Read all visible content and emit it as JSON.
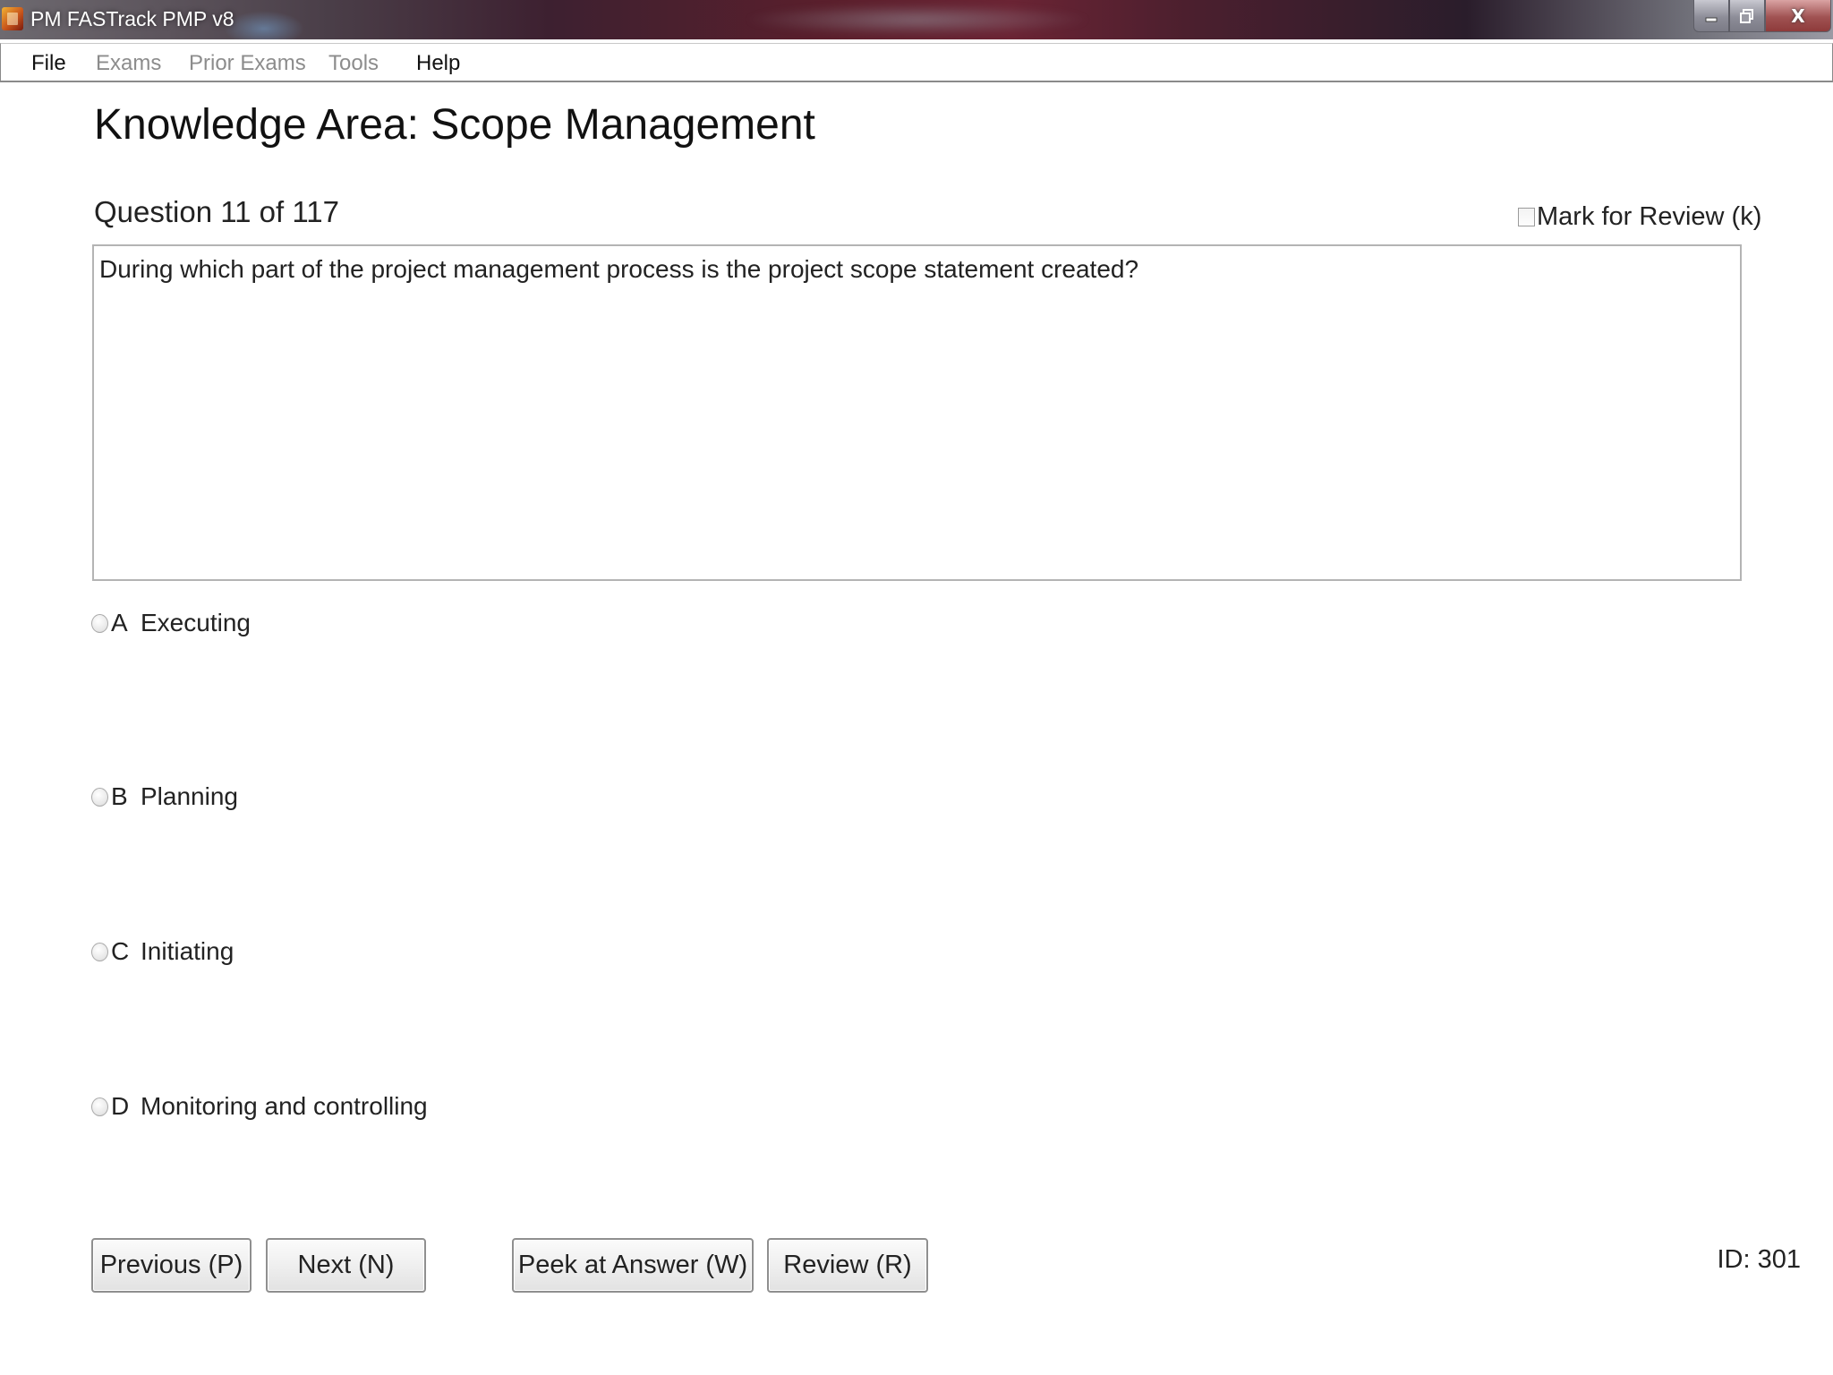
{
  "window": {
    "title": "PM FASTrack PMP v8",
    "controls": {
      "minimize_icon": "minimize-icon",
      "maximize_icon": "restore-icon",
      "close_label": "X"
    }
  },
  "menu": {
    "items": [
      {
        "label": "File",
        "enabled": true
      },
      {
        "label": "Exams",
        "enabled": false
      },
      {
        "label": "Prior Exams",
        "enabled": false
      },
      {
        "label": "Tools",
        "enabled": false
      },
      {
        "label": "Help",
        "enabled": true
      }
    ]
  },
  "page": {
    "heading": "Knowledge Area: Scope Management",
    "question_counter": "Question 11 of 117",
    "mark_for_review": {
      "label": "Mark for Review (k)",
      "checked": false
    },
    "question_text": "During which part of the project management process is the project scope statement created?",
    "answers": [
      {
        "letter": "A",
        "text": "Executing",
        "selected": false
      },
      {
        "letter": "B",
        "text": "Planning",
        "selected": false
      },
      {
        "letter": "C",
        "text": "Initiating",
        "selected": false
      },
      {
        "letter": "D",
        "text": "Monitoring and controlling",
        "selected": false
      }
    ]
  },
  "buttons": {
    "previous": "Previous (P)",
    "next": "Next (N)",
    "peek": "Peek at Answer (W)",
    "review": "Review (R)"
  },
  "footer": {
    "id_label": "ID: 301"
  }
}
